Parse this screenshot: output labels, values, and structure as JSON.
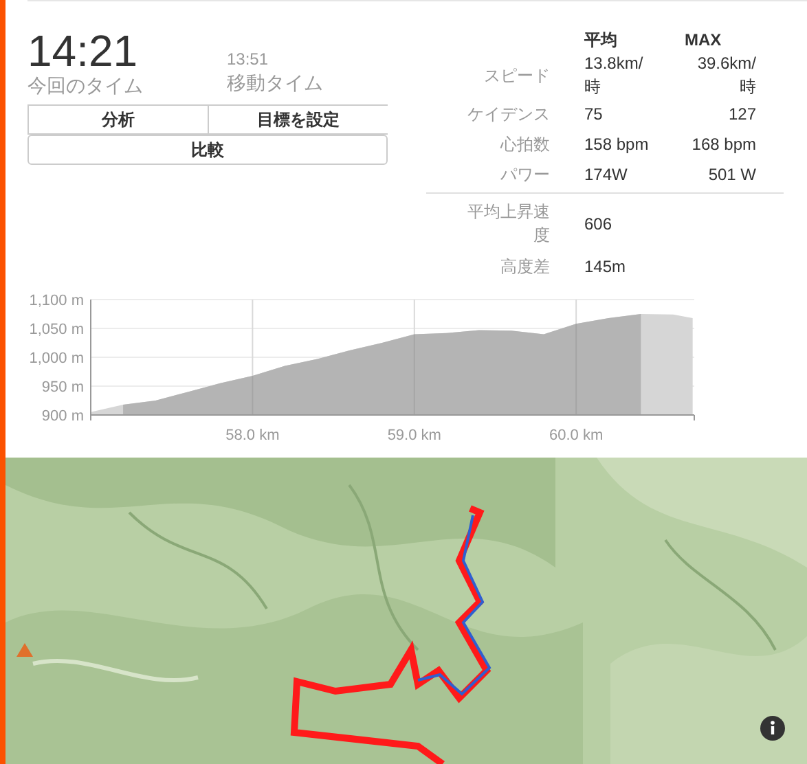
{
  "summary": {
    "elapsed": {
      "value": "14:21",
      "label": "今回のタイム"
    },
    "moving": {
      "value": "13:51",
      "label": "移動タイム"
    }
  },
  "buttons": [
    [
      {
        "label": "分析"
      },
      {
        "label": "目標を設定"
      }
    ],
    [
      {
        "label": "比較"
      }
    ]
  ],
  "stats": {
    "columns": [
      "平均",
      "MAX"
    ],
    "rows": [
      {
        "label": "スピード",
        "average": "13.8km/時",
        "max": "39.6km/時"
      },
      {
        "label": "ケイデンス",
        "average": "75",
        "max": "127"
      },
      {
        "label": "心拍数",
        "average": "158 bpm",
        "max": "168 bpm"
      },
      {
        "label": "パワー",
        "average": "174W",
        "max": "501 W"
      }
    ],
    "extra_rows": [
      {
        "label": "平均上昇速度",
        "average": "606"
      },
      {
        "label": "高度差",
        "average": "145m"
      }
    ]
  },
  "elevation": {
    "chart_data": {
      "type": "area",
      "x": [
        57.0,
        57.2,
        57.4,
        57.6,
        57.8,
        58.0,
        58.2,
        58.4,
        58.6,
        58.8,
        59.0,
        59.2,
        59.4,
        59.6,
        59.8,
        60.0,
        60.2,
        60.4,
        60.6,
        60.72
      ],
      "series": [
        {
          "color": "#d6d6d6",
          "values": [
            905,
            918,
            925,
            940,
            955,
            968,
            985,
            997,
            1012,
            1025,
            1040,
            1042,
            1047,
            1046,
            1040,
            1058,
            1068,
            1075,
            1074,
            1068
          ]
        },
        {
          "color": "#b4b4b4",
          "values": [
            null,
            918,
            925,
            940,
            955,
            968,
            985,
            997,
            1012,
            1025,
            1040,
            1042,
            1047,
            1046,
            1040,
            1058,
            1068,
            1075,
            null,
            null
          ]
        }
      ],
      "xlim": [
        57.0,
        60.73
      ],
      "ylim": [
        900,
        1100
      ],
      "grid": true,
      "xticks": [
        {
          "value": 58,
          "label": "58.0 km"
        },
        {
          "value": 59,
          "label": "59.0 km"
        },
        {
          "value": 60,
          "label": "60.0 km"
        }
      ],
      "yticks": [
        {
          "value": 900,
          "label": "900 m"
        },
        {
          "value": 950,
          "label": "950 m"
        },
        {
          "value": 1000,
          "label": "1,000 m"
        },
        {
          "value": 1050,
          "label": "1,050 m"
        },
        {
          "value": 1100,
          "label": "1,100 m"
        }
      ]
    }
  },
  "map": {
    "kind": "picture"
  }
}
